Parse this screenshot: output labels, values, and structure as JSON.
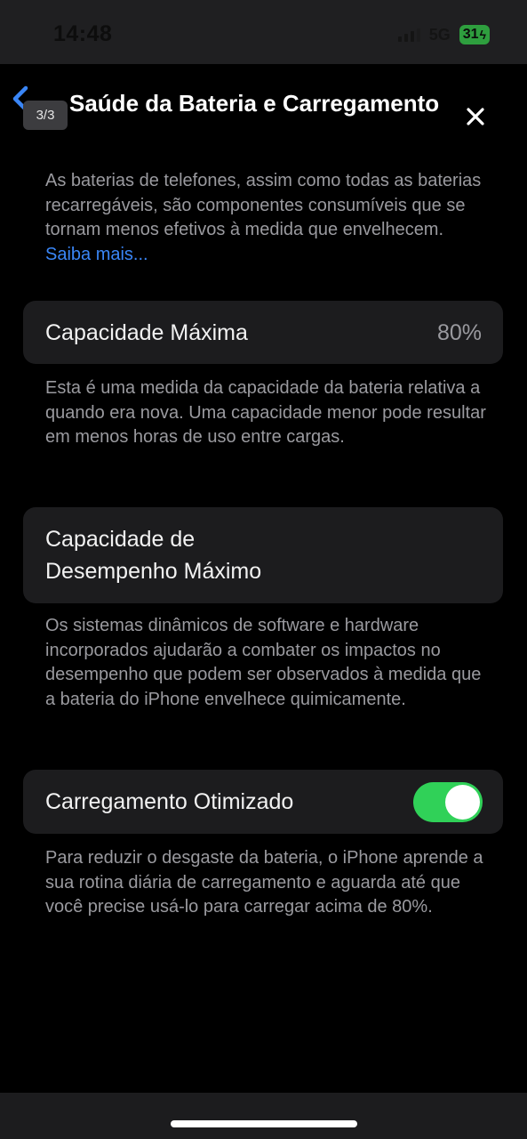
{
  "status_bar": {
    "time": "14:48",
    "network": "5G",
    "battery": "31"
  },
  "viewer": {
    "page_counter": "3/3"
  },
  "nav": {
    "title": "Saúde da Bateria e Carregamento"
  },
  "intro": {
    "text": "As baterias de telefones, assim como todas as baterias recarregáveis, são componentes consumíveis que se tornam menos efetivos à medida que envelhecem. ",
    "link": "Saiba mais..."
  },
  "max_capacity": {
    "label": "Capacidade Máxima",
    "value": "80%",
    "description": "Esta é uma medida da capacidade da bateria relativa a quando era nova. Uma capacidade menor pode resultar em menos horas de uso entre cargas."
  },
  "peak_performance": {
    "label_line1": "Capacidade de",
    "label_line2": "Desempenho Máximo",
    "description": "Os sistemas dinâmicos de software e hardware incorporados ajudarão a combater os impactos no desempenho que podem ser observados à medida que a bateria do iPhone envelhece quimicamente."
  },
  "optimized_charging": {
    "label": "Carregamento Otimizado",
    "enabled": true,
    "description": "Para reduzir o desgaste da bateria, o iPhone aprende a sua rotina diária de carregamento e aguarda até que você precise usá-lo para carregar acima de 80%."
  },
  "colors": {
    "accent_link": "#3a86f6",
    "toggle_on": "#30d158",
    "card_bg": "#1c1c1e"
  }
}
